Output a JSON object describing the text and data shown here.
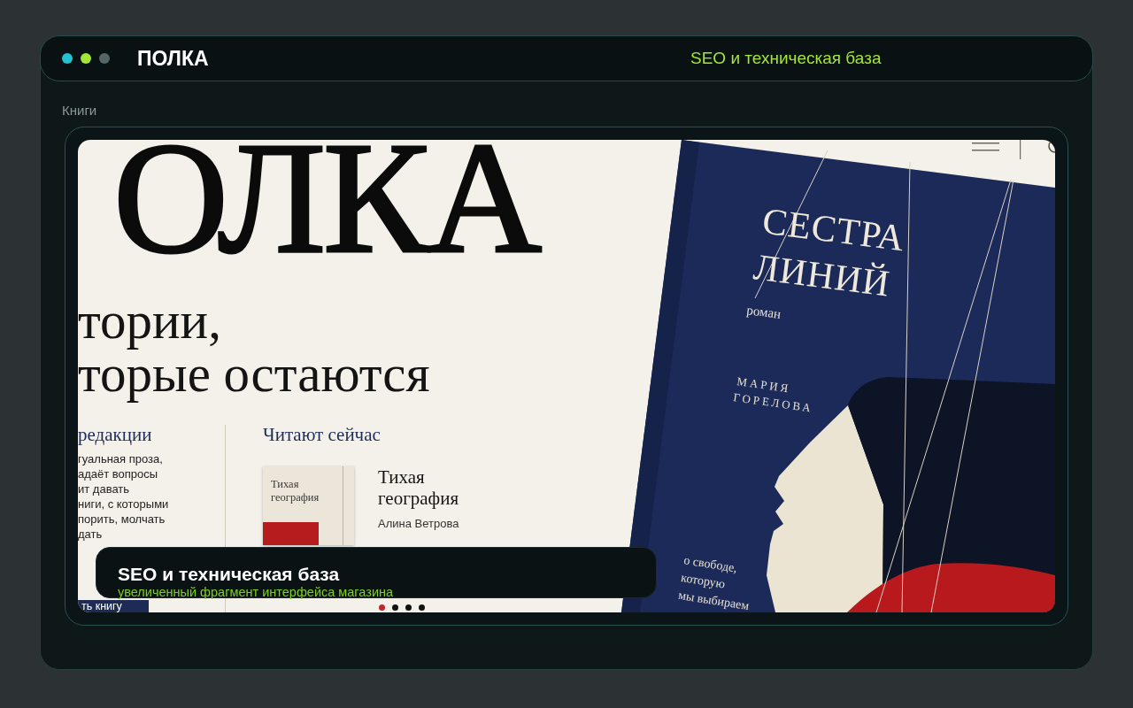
{
  "window": {
    "controls": [
      {
        "color": "#22c3d0"
      },
      {
        "color": "#a3e635"
      },
      {
        "color": "#56656a"
      }
    ],
    "title": "ПОЛКА",
    "subtitle": "SEO и техническая база"
  },
  "section_label": "Книги",
  "preview": {
    "hero": {
      "wordmark": "ОЛКА",
      "tagline": "тории,\nторые остаются"
    },
    "editors_column": {
      "heading": "редакции",
      "text": "гуальная проза,\nадаёт вопросы\nит давать\nниги, с которыми\nпорить, молчать\nдать",
      "button": "ть книгу"
    },
    "reading_now": {
      "heading": "Читают сейчас",
      "book": {
        "cover_title": "Тихая география",
        "title": "Тихая география",
        "author": "Алина Ветрова"
      },
      "carousel_dots": [
        {
          "selected": true
        },
        {
          "selected": false
        },
        {
          "selected": false
        },
        {
          "selected": false
        }
      ]
    },
    "featured_cover": {
      "title": "СЕСТРА\nЛИНИЙ",
      "genre": "роман",
      "author": "МАРИЯ\nГОРЕЛОВА",
      "blurb": "о свободе,\nкоторую\nмы выбираем"
    }
  },
  "caption": {
    "title": "SEO и техническая база",
    "subtitle": "увеличенный фрагмент интерфейса магазина"
  }
}
